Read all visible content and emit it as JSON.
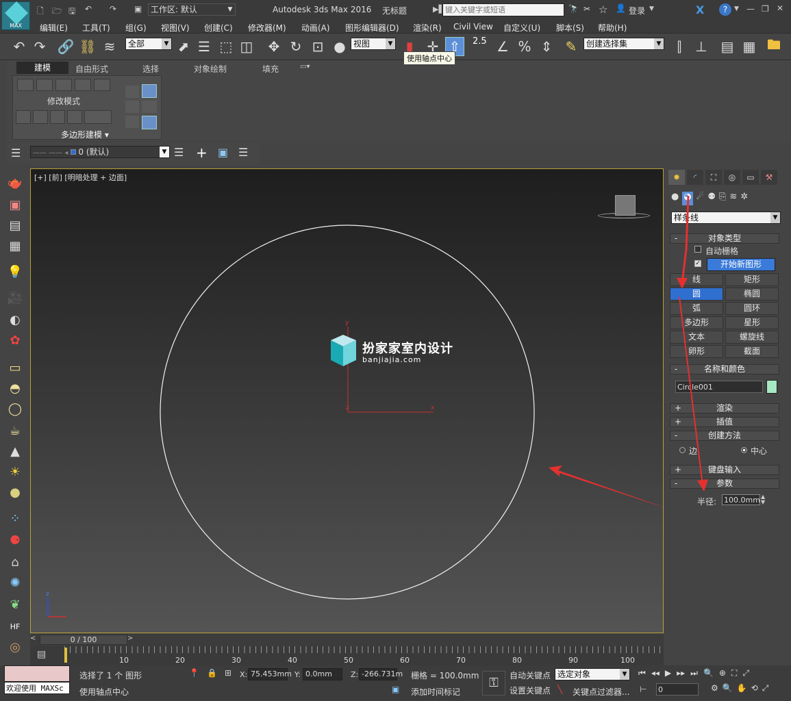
{
  "titlebar": {
    "app_title": "Autodesk 3ds Max 2016",
    "doc_title": "无标题",
    "workspace_label": "工作区: 默认",
    "search_placeholder": "键入关键字或短语",
    "login_label": "登录",
    "logo_text": "MAX"
  },
  "menu": [
    "编辑(E)",
    "工具(T)",
    "组(G)",
    "视图(V)",
    "创建(C)",
    "修改器(M)",
    "动画(A)",
    "图形编辑器(D)",
    "渲染(R)",
    "Civil View",
    "自定义(U)",
    "脚本(S)",
    "帮助(H)"
  ],
  "toolbar": {
    "filter_value": "全部",
    "coord_value": "视图",
    "selection_set_placeholder": "创建选择集",
    "snap_value": "2.5",
    "tooltip": "使用轴点中心"
  },
  "ribbon": {
    "tabs": [
      "建模",
      "自由形式",
      "选择",
      "对象绘制",
      "填充"
    ],
    "group_label": "修改模式",
    "footer_label": "多边形建模"
  },
  "layer": {
    "value": "0 (默认)"
  },
  "viewport": {
    "label": "[+] [前] [明暗处理 + 边面]",
    "watermark_title": "扮家家室内设计",
    "watermark_url": "banjiajia.com",
    "axis_x": "x",
    "axis_y": "y",
    "axis_z": "z"
  },
  "cmdpanel": {
    "category_value": "样条线",
    "object_type_header": "对象类型",
    "autogrid_label": "自动栅格",
    "start_new_shape": "开始新图形",
    "buttons": [
      "线",
      "矩形",
      "圆",
      "椭圆",
      "弧",
      "圆环",
      "多边形",
      "星形",
      "文本",
      "螺旋线",
      "卵形",
      "截面"
    ],
    "name_color_header": "名称和颜色",
    "object_name": "Circle001",
    "object_color": "#a6e8c2",
    "render_header": "渲染",
    "interp_header": "插值",
    "create_method_header": "创建方法",
    "create_method_edge": "边",
    "create_method_center": "中心",
    "keyboard_header": "键盘输入",
    "params_header": "参数",
    "radius_label": "半径:",
    "radius_value": "100.0mm"
  },
  "timeline": {
    "frame_label": "0 / 100",
    "ticks": [
      "10",
      "20",
      "30",
      "40",
      "50",
      "60",
      "70",
      "80",
      "90",
      "100"
    ]
  },
  "status": {
    "welcome": "欢迎使用 MAXSc",
    "selected": "选择了 1 个 图形",
    "prompt": "使用轴点中心",
    "x_label": "X:",
    "x_value": "75.453mm",
    "y_label": "Y:",
    "y_value": "0.0mm",
    "z_label": "Z:",
    "z_value": "-266.731m",
    "grid": "栅格 = 100.0mm",
    "add_time_tag": "添加时间标记",
    "auto_key": "自动关键点",
    "set_key": "设置关键点",
    "selected_obj": "选定对象",
    "key_filters": "关键点过滤器...",
    "frame_value": "0"
  }
}
